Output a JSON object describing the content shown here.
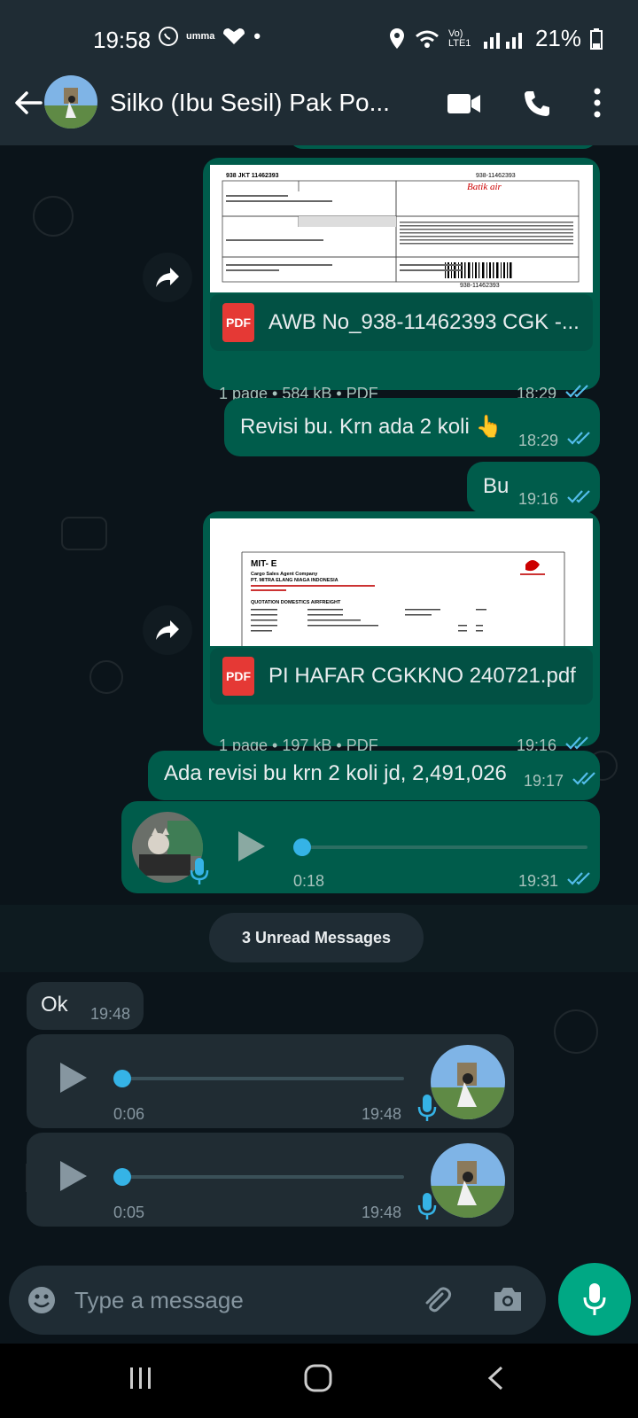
{
  "status_bar": {
    "time": "19:58",
    "app_icons": [
      "whatsapp-icon",
      "umma-icon",
      "laz-icon",
      "dot-icon"
    ],
    "battery": "21%",
    "network_label": "Vo) LTE1"
  },
  "header": {
    "title": "Silko (Ibu Sesil) Pak Po...",
    "icons": [
      "back-arrow-icon",
      "avatar",
      "video-call-icon",
      "phone-icon",
      "more-vert-icon"
    ]
  },
  "messages": {
    "awb": {
      "name": "AWB No_938-11462393 CGK -...",
      "meta": "1 page • 584 kB • PDF",
      "time": "18:29",
      "thumb": {
        "code": "938 JKT 11462393",
        "right": "938-11462393",
        "airline": "Batik air",
        "barcode": "938-11462393"
      }
    },
    "revisi": {
      "text": "Revisi bu. Krn ada 2 koli 👆",
      "time": "18:29"
    },
    "bu": {
      "text": "Bu",
      "time": "19:16"
    },
    "pi": {
      "name": "PI HAFAR CGKKNO 240721.pdf",
      "meta": "1 page • 197 kB • PDF",
      "time": "19:16",
      "thumb": {
        "heading": "MIT- E",
        "sub": "Cargo Sales Agent Company",
        "company": "PT. MITRA ELANG NIAGA INDONESIA",
        "quote": "QUOTATION DOMESTICS AIRFREIGHT"
      }
    },
    "ada_revisi": {
      "text": "Ada revisi bu krn 2 koli jd, 2,491,026",
      "time": "19:17"
    },
    "voice_out": {
      "duration": "0:18",
      "time": "19:31",
      "progress": 0
    },
    "unread": "3 Unread Messages",
    "ok": {
      "text": "Ok",
      "time": "19:48"
    },
    "voice_in_1": {
      "duration": "0:06",
      "time": "19:48",
      "progress": 0
    },
    "voice_in_2": {
      "duration": "0:05",
      "time": "19:48",
      "progress": 0
    }
  },
  "input": {
    "placeholder": "Type a message"
  },
  "pdf_label": "PDF",
  "colors": {
    "outgoing": "#005c4b",
    "incoming": "#202c33",
    "accent": "#00a884",
    "read_ticks": "#53bdeb"
  }
}
